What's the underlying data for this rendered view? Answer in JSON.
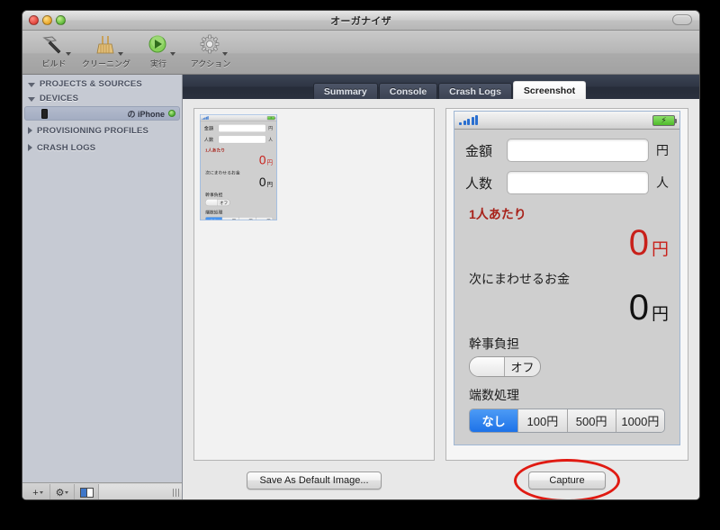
{
  "window": {
    "title": "オーガナイザ",
    "traffic_lights": [
      "close",
      "minimize",
      "zoom"
    ],
    "toolbar_toggle": "toolbar-toggle-pill"
  },
  "toolbar": {
    "items": [
      {
        "label": "ビルド",
        "icon": "hammer-icon",
        "has_menu": true
      },
      {
        "label": "クリーニング",
        "icon": "broom-icon",
        "has_menu": true
      },
      {
        "label": "実行",
        "icon": "run-play-icon",
        "has_menu": true
      },
      {
        "label": "アクション",
        "icon": "gear-icon",
        "has_menu": true
      }
    ]
  },
  "sidebar": {
    "groups": [
      {
        "label": "PROJECTS & SOURCES",
        "expanded": true
      },
      {
        "label": "DEVICES",
        "expanded": true
      },
      {
        "label": "PROVISIONING PROFILES",
        "expanded": false
      },
      {
        "label": "CRASH LOGS",
        "expanded": false
      }
    ],
    "device": {
      "name": "の iPhone",
      "icon": "iphone-device-icon",
      "status": "connected",
      "status_color": "#5fb93a",
      "selected": true
    },
    "bottom_bar": {
      "add_label": "+",
      "gear_label": "⚙",
      "panel_toggle": "panel-toggle-icon",
      "resize_grip": "resize-grip"
    }
  },
  "tabs": [
    {
      "label": "Summary",
      "active": false
    },
    {
      "label": "Console",
      "active": false
    },
    {
      "label": "Crash Logs",
      "active": false
    },
    {
      "label": "Screenshot",
      "active": true
    }
  ],
  "left_pane": {
    "button_label": "Save As Default Image...",
    "button_mnemonic": "g"
  },
  "right_pane": {
    "button_label": "Capture",
    "annotation": {
      "shape": "ellipse",
      "color": "#e01a12",
      "target": "Capture"
    }
  },
  "screenshot_content": {
    "status_bar": {
      "signal_icon": "signal-bars-icon",
      "signal_bars": 5,
      "signal_color": "#2a6fd0",
      "battery_icon": "battery-charging-icon",
      "battery_color": "#4fbb2a"
    },
    "fields": [
      {
        "label": "金額",
        "value": "",
        "unit": "円"
      },
      {
        "label": "人数",
        "value": "",
        "unit": "人"
      }
    ],
    "results": [
      {
        "label": "1人あたり",
        "label_color": "#a8231b",
        "value": "0",
        "unit": "円",
        "value_color": "#c8201a"
      },
      {
        "label": "次にまわせるお金",
        "label_color": "#1c1c1c",
        "value": "0",
        "unit": "円",
        "value_color": "#111111"
      }
    ],
    "toggle": {
      "label": "幹事負担",
      "state_text": "オフ",
      "on": false
    },
    "segmented": {
      "label": "端数処理",
      "options": [
        "なし",
        "100円",
        "500円",
        "1000円"
      ],
      "selected_index": 0,
      "selected_color": "#1d72e8"
    }
  }
}
